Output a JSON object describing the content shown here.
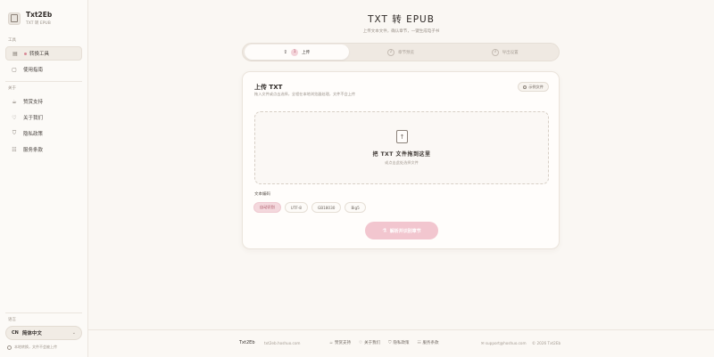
{
  "app": {
    "name": "Txt2Eb",
    "subtitle": "TXT 转 EPUB"
  },
  "sidebar": {
    "section_tools": "工具",
    "tools": [
      {
        "label": "转换工具",
        "icon": "file-icon",
        "active": true
      },
      {
        "label": "使用指南",
        "icon": "book-icon",
        "active": false
      }
    ],
    "section_about": "关于",
    "about": [
      {
        "label": "赞赏支持",
        "icon": "coffee-icon"
      },
      {
        "label": "关于我们",
        "icon": "heart-icon"
      },
      {
        "label": "隐私政策",
        "icon": "shield-icon"
      },
      {
        "label": "服务条款",
        "icon": "terms-icon"
      }
    ],
    "section_language": "语言",
    "language": {
      "code": "CN",
      "label": "简体中文",
      "hint": "本地转换，文件不会被上传"
    }
  },
  "page": {
    "title": "TXT 转 EPUB",
    "subtitle": "上传文本文件，确认章节，一键生成电子书"
  },
  "stepper": [
    {
      "num": "1",
      "label": "上传",
      "active": true
    },
    {
      "num": "2",
      "label": "章节预览",
      "active": false
    },
    {
      "num": "3",
      "label": "导出设置",
      "active": false
    }
  ],
  "upload": {
    "title": "上传 TXT",
    "description": "拖入文件或点击选择，全程在本地浏览器处理，文件不会上传",
    "sample_button": "示例文件",
    "dropzone_title": "把 TXT 文件拖到这里",
    "dropzone_sub": "或点击此处选择文件",
    "encoding_label": "文本编码",
    "encodings": [
      {
        "label": "自动识别",
        "active": true
      },
      {
        "label": "UTF-8",
        "active": false
      },
      {
        "label": "GB18030",
        "active": false
      },
      {
        "label": "Big5",
        "active": false
      }
    ],
    "convert_button": "解析并识别章节"
  },
  "footer": {
    "brand": "Txt2Eb",
    "domain": "txt2eb.hoshuo.com",
    "links": [
      {
        "label": "赞赏支持",
        "icon": "coffee-icon"
      },
      {
        "label": "关于我们",
        "icon": "heart-icon"
      },
      {
        "label": "隐私政策",
        "icon": "shield-icon"
      },
      {
        "label": "服务条款",
        "icon": "terms-icon"
      }
    ],
    "email": "support@hoshuo.com",
    "copyright": "© 2026 Txt2Eb"
  },
  "colors": {
    "accent": "#f2c6cf",
    "accent_text": "#a85261",
    "background": "#faf7f3"
  }
}
